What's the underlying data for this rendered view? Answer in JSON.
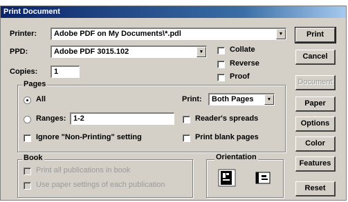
{
  "window": {
    "title": "Print Document"
  },
  "printer": {
    "label": "Printer:",
    "value": "Adobe PDF on My Documents\\*.pdl"
  },
  "ppd": {
    "label": "PPD:",
    "value": "Adobe PDF 3015.102"
  },
  "copies": {
    "label": "Copies:",
    "value": "1"
  },
  "options": {
    "collate": "Collate",
    "reverse": "Reverse",
    "proof": "Proof"
  },
  "pages": {
    "group_label": "Pages",
    "all_label": "All",
    "ranges_label": "Ranges:",
    "ranges_value": "1-2",
    "ignore_label": "Ignore \"Non-Printing\" setting",
    "print_label": "Print:",
    "print_value": "Both Pages",
    "readers_label": "Reader's spreads",
    "blank_label": "Print blank pages"
  },
  "book": {
    "group_label": "Book",
    "print_all": "Print all publications in book",
    "use_paper": "Use paper settings of each publication"
  },
  "orientation": {
    "label": "Orientation",
    "portrait_icon": "portrait-page-icon",
    "landscape_icon": "landscape-page-icon"
  },
  "buttons": {
    "print": "Print",
    "cancel": "Cancel",
    "document": "Document",
    "paper": "Paper",
    "options": "Options",
    "color": "Color",
    "features": "Features",
    "reset": "Reset"
  }
}
